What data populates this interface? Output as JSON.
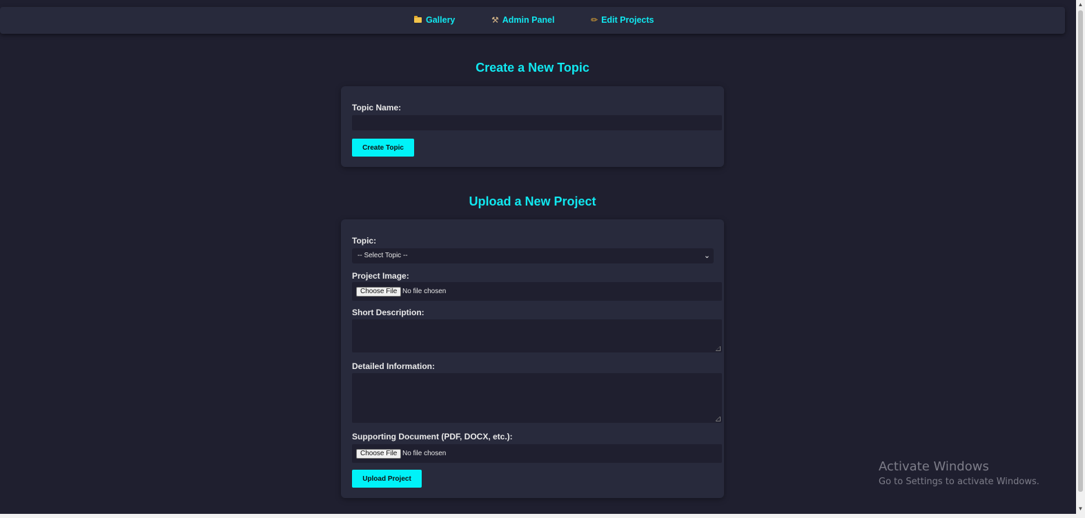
{
  "nav": {
    "items": [
      {
        "label": "Gallery",
        "icon": "folder-icon"
      },
      {
        "label": "Admin Panel",
        "icon": "tools-icon"
      },
      {
        "label": "Edit Projects",
        "icon": "pencil-icon"
      }
    ]
  },
  "create_topic": {
    "title": "Create a New Topic",
    "topic_name_label": "Topic Name:",
    "topic_name_value": "",
    "submit_label": "Create Topic"
  },
  "upload_project": {
    "title": "Upload a New Project",
    "topic_label": "Topic:",
    "topic_selected": "-- Select Topic --",
    "image_label": "Project Image:",
    "image_button": "Choose File",
    "image_status": "No file chosen",
    "short_desc_label": "Short Description:",
    "detailed_label": "Detailed Information:",
    "document_label": "Supporting Document (PDF, DOCX, etc.):",
    "document_button": "Choose File",
    "document_status": "No file chosen",
    "submit_label": "Upload Project"
  },
  "watermark": {
    "title": "Activate Windows",
    "subtitle": "Go to Settings to activate Windows."
  },
  "colors": {
    "background": "#1f1f2f",
    "card": "#282a3c",
    "accent": "#11e8f0",
    "button": "#00f2f8"
  }
}
